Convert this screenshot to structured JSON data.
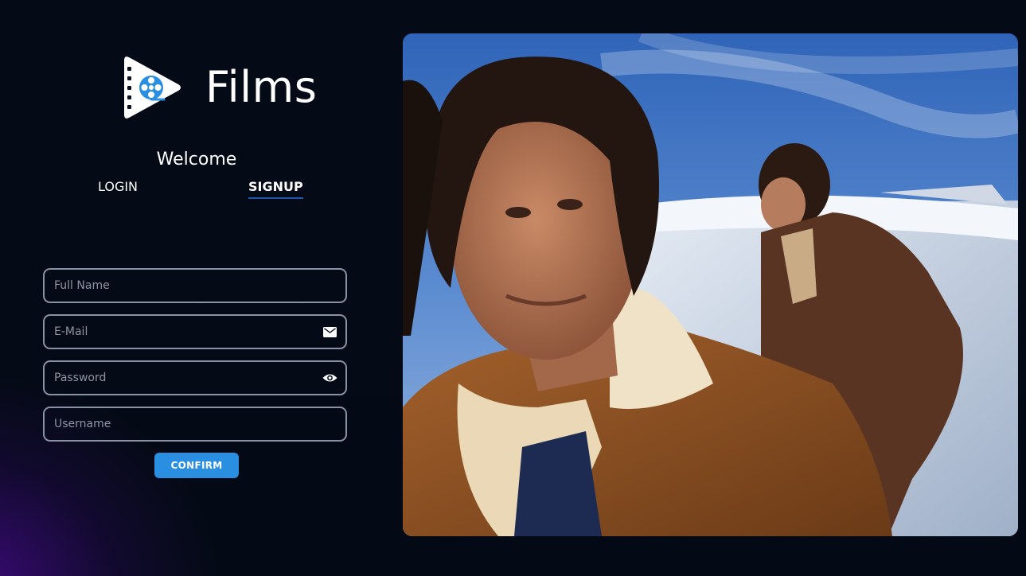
{
  "brand": {
    "name": "Films",
    "logo_icon": "film-reel-play-icon",
    "logo_color": "#2a8fe0"
  },
  "auth": {
    "welcome": "Welcome",
    "tabs": [
      {
        "label": "LOGIN",
        "active": false
      },
      {
        "label": "SIGNUP",
        "active": true
      }
    ],
    "fields": {
      "full_name": {
        "placeholder": "Full Name",
        "value": ""
      },
      "email": {
        "placeholder": "E-Mail",
        "value": "",
        "icon": "envelope-icon"
      },
      "password": {
        "placeholder": "Password",
        "value": "",
        "icon": "eye-icon"
      },
      "username": {
        "placeholder": "Username",
        "value": ""
      }
    },
    "confirm_label": "CONFIRM"
  },
  "colors": {
    "background": "#050a14",
    "accent": "#2a8fe0",
    "tab_underline": "#1e56b0",
    "glow": "#46108c"
  }
}
